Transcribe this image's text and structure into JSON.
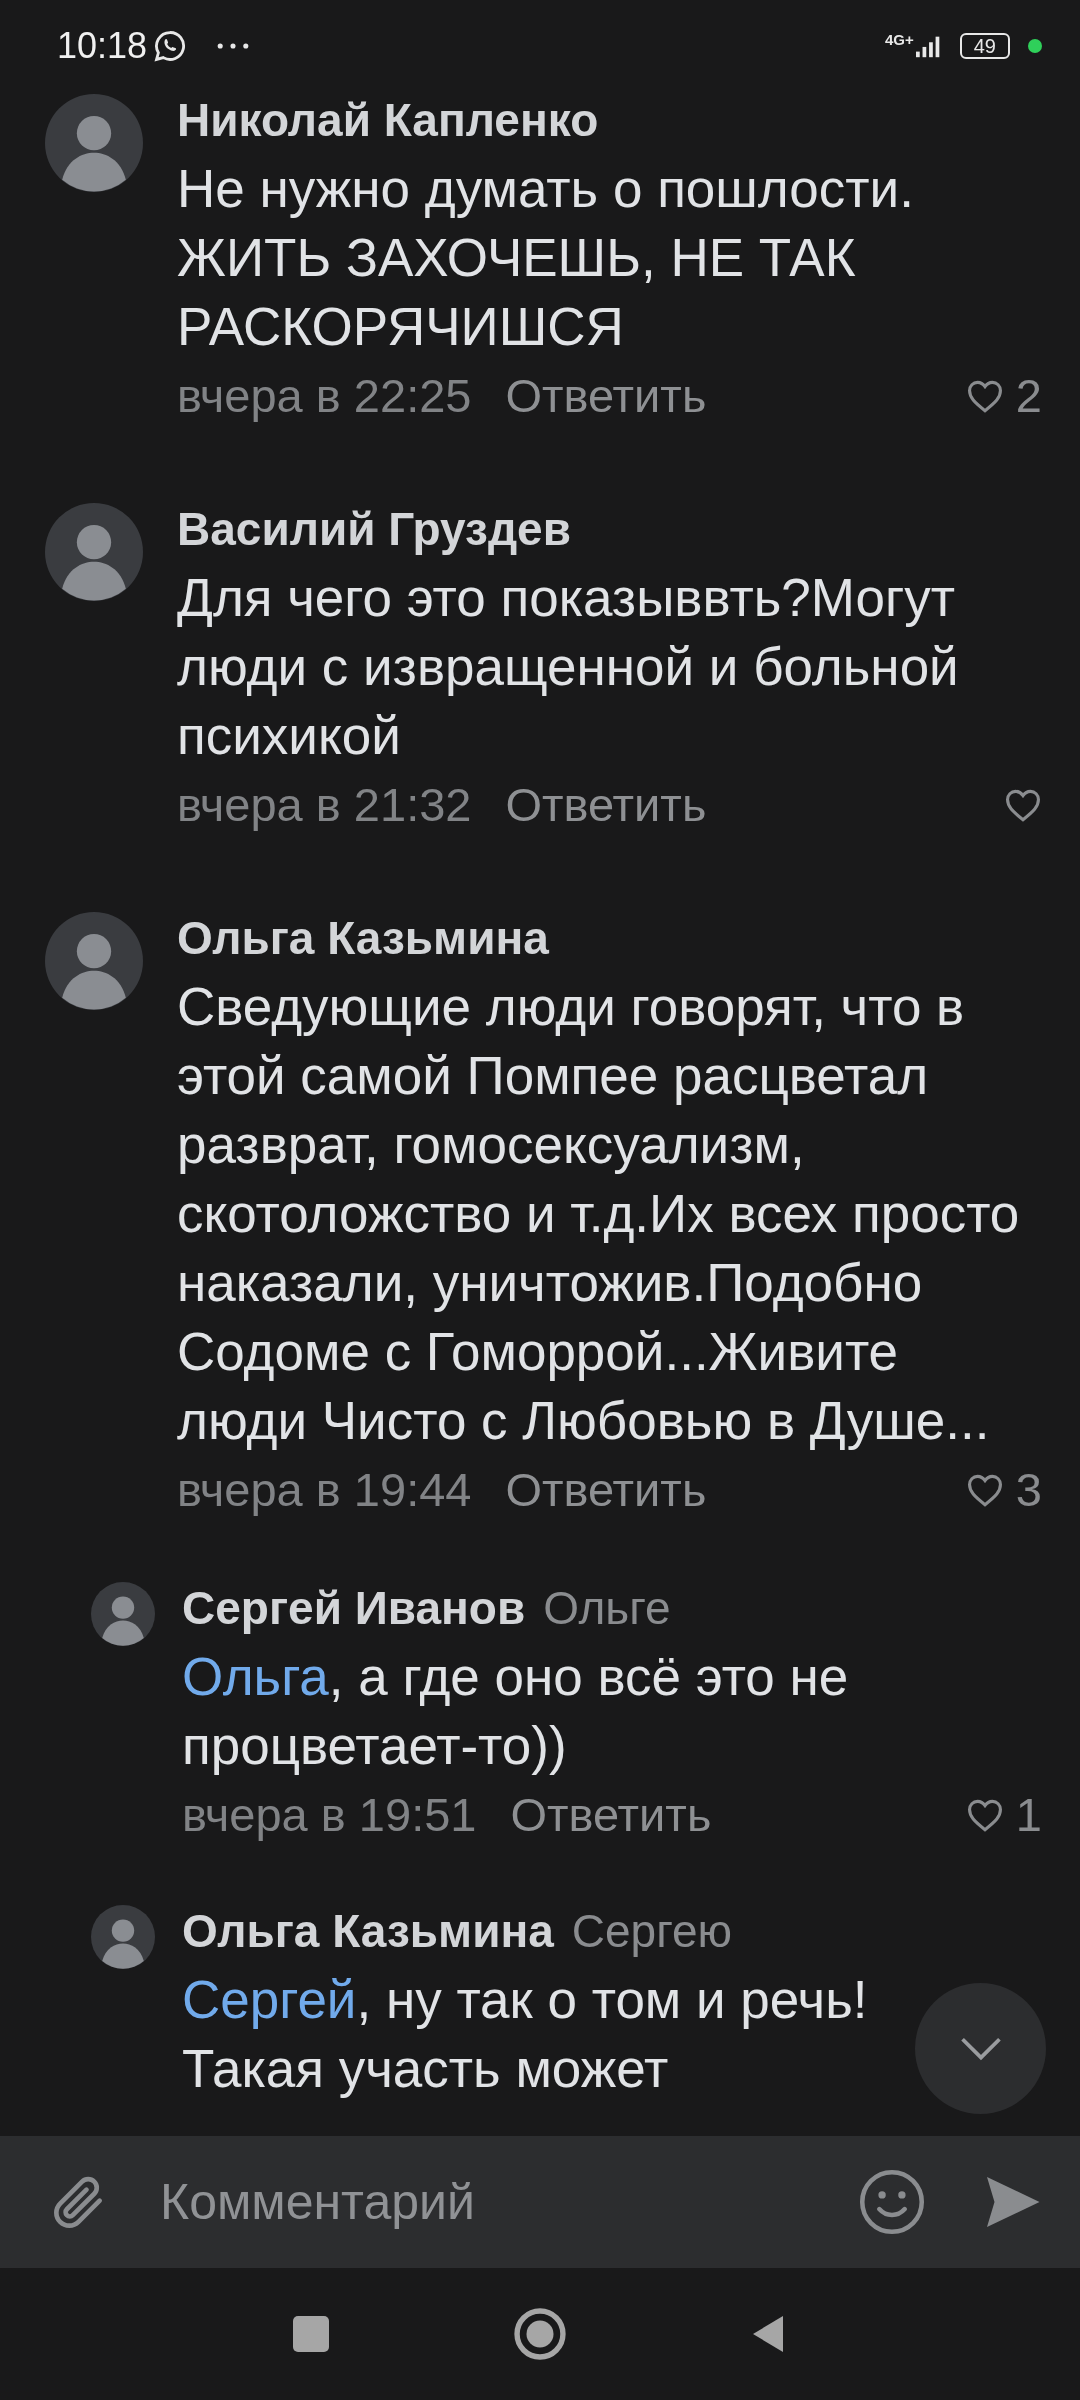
{
  "status_bar": {
    "time": "10:18",
    "network": "4G+",
    "battery": "49"
  },
  "comments": [
    {
      "author": "Николай Капленко",
      "text": "Не нужно думать о пошлости. ЖИТЬ ЗАХОЧЕШЬ, НЕ ТАК РАСКОРЯЧИШСЯ",
      "time": "вчера в 22:25",
      "reply_label": "Ответить",
      "likes": "2"
    },
    {
      "author": "Василий Груздев",
      "text": "Для чего это показыввть?Могут люди с извращенной и больной психикой",
      "time": "вчера в 21:32",
      "reply_label": "Ответить"
    },
    {
      "author": "Ольга Казьмина",
      "text": "Сведующие люди говорят, что в этой самой Помпее расцветал разврат, гомосексуализм, скотоложство  и т.д.Их всех просто наказали, уничтожив.Подобно Содоме с Гоморрой...Живите люди Чисто с Любовью в Душе...",
      "time": "вчера в 19:44",
      "reply_label": "Ответить",
      "likes": "3",
      "replies": [
        {
          "author": "Сергей Иванов",
          "reply_to": "Ольге",
          "mention": "Ольга",
          "text": ", а где оно всё это не процветает-то))",
          "time": "вчера в 19:51",
          "reply_label": "Ответить",
          "likes": "1"
        },
        {
          "author": "Ольга Казьмина",
          "reply_to": "Сергею",
          "mention": "Сергей",
          "text": ", ну так о том и речь! Такая участь может"
        }
      ]
    }
  ],
  "composer": {
    "placeholder": "Комментарий"
  }
}
